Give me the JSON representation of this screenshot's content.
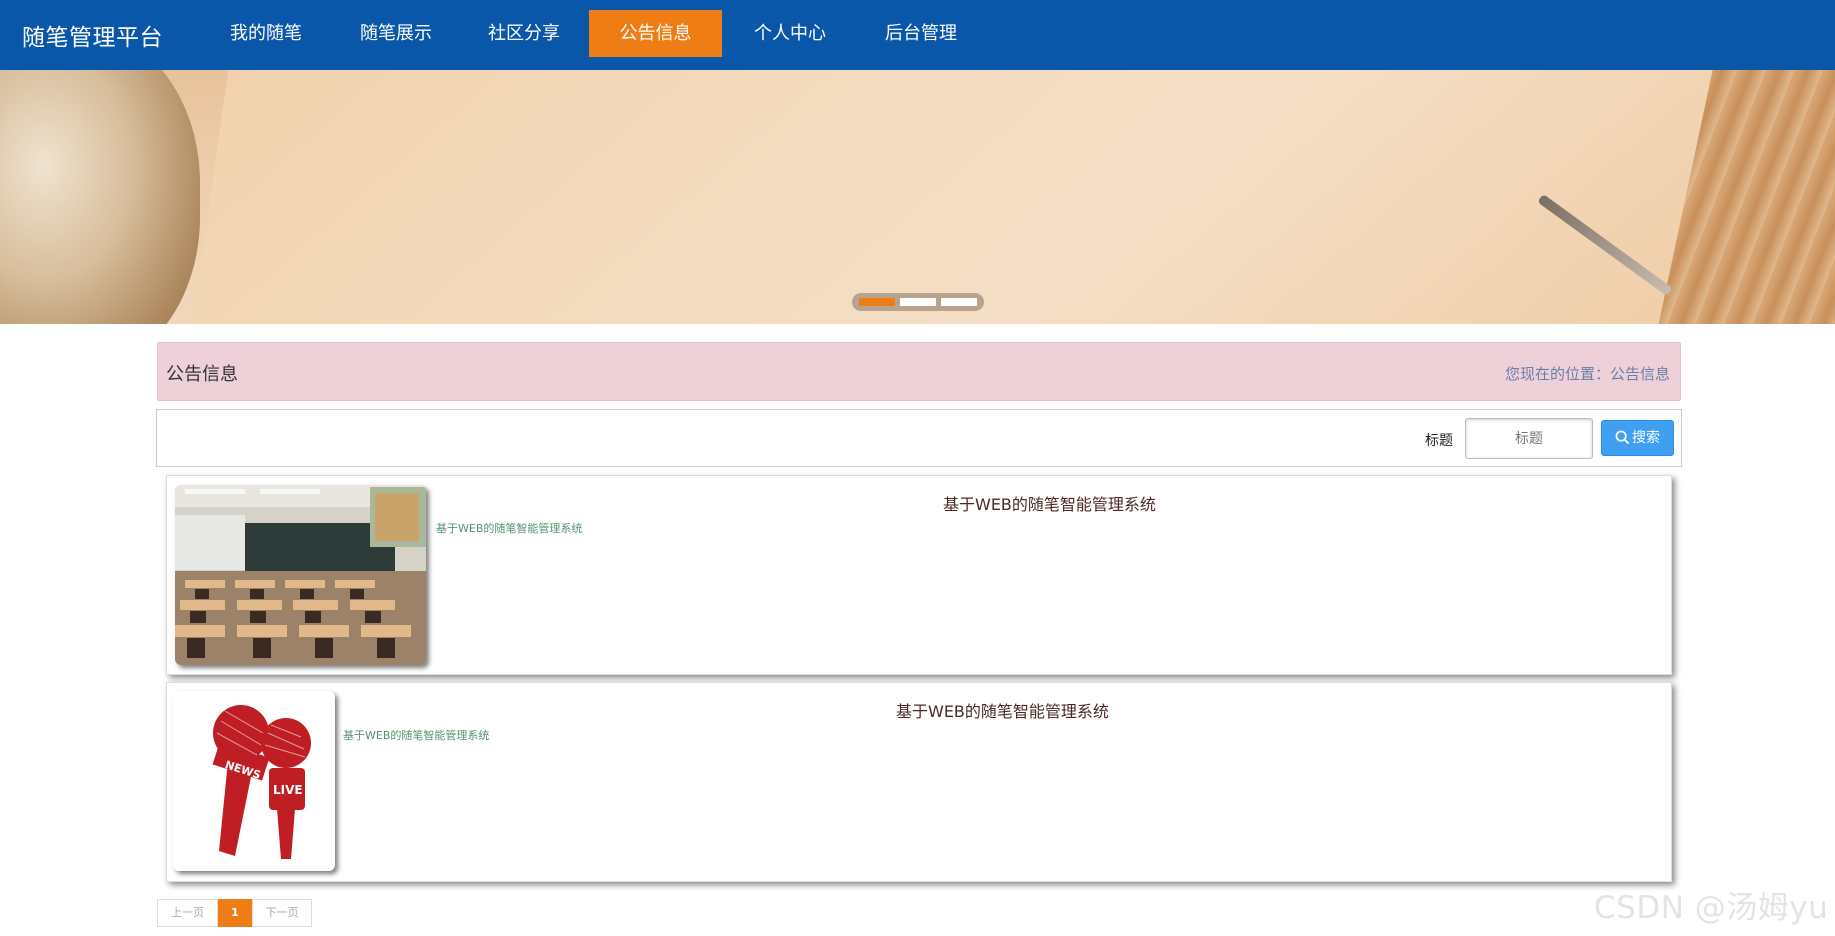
{
  "brand": "随笔管理平台",
  "nav": {
    "items": [
      {
        "label": "我的随笔"
      },
      {
        "label": "随笔展示"
      },
      {
        "label": "社区分享"
      },
      {
        "label": "公告信息"
      },
      {
        "label": "个人中心"
      },
      {
        "label": "后台管理"
      }
    ],
    "active_index": 3
  },
  "banner": {
    "slide_count": 3,
    "active_slide": 0
  },
  "notice_header": {
    "title": "公告信息",
    "location": "您现在的位置：公告信息"
  },
  "search": {
    "label": "标题",
    "placeholder": "标题",
    "button_label": "搜索"
  },
  "notices": [
    {
      "title": "基于WEB的随笔智能管理系统",
      "description": "基于WEB的随笔智能管理系统",
      "image_icon": "classroom-photo"
    },
    {
      "title": "基于WEB的随笔智能管理系统",
      "description": "基于WEB的随笔智能管理系统",
      "image_icon": "news-microphone-icon"
    }
  ],
  "pagination": {
    "prev_label": "上一页",
    "current": "1",
    "next_label": "下一页"
  },
  "watermark": "CSDN @汤姆yu",
  "colors": {
    "nav_bg": "#0a57aa",
    "accent": "#ee7d16",
    "notice_bar_bg": "#eed0d9",
    "search_button": "#3fa0f3"
  }
}
